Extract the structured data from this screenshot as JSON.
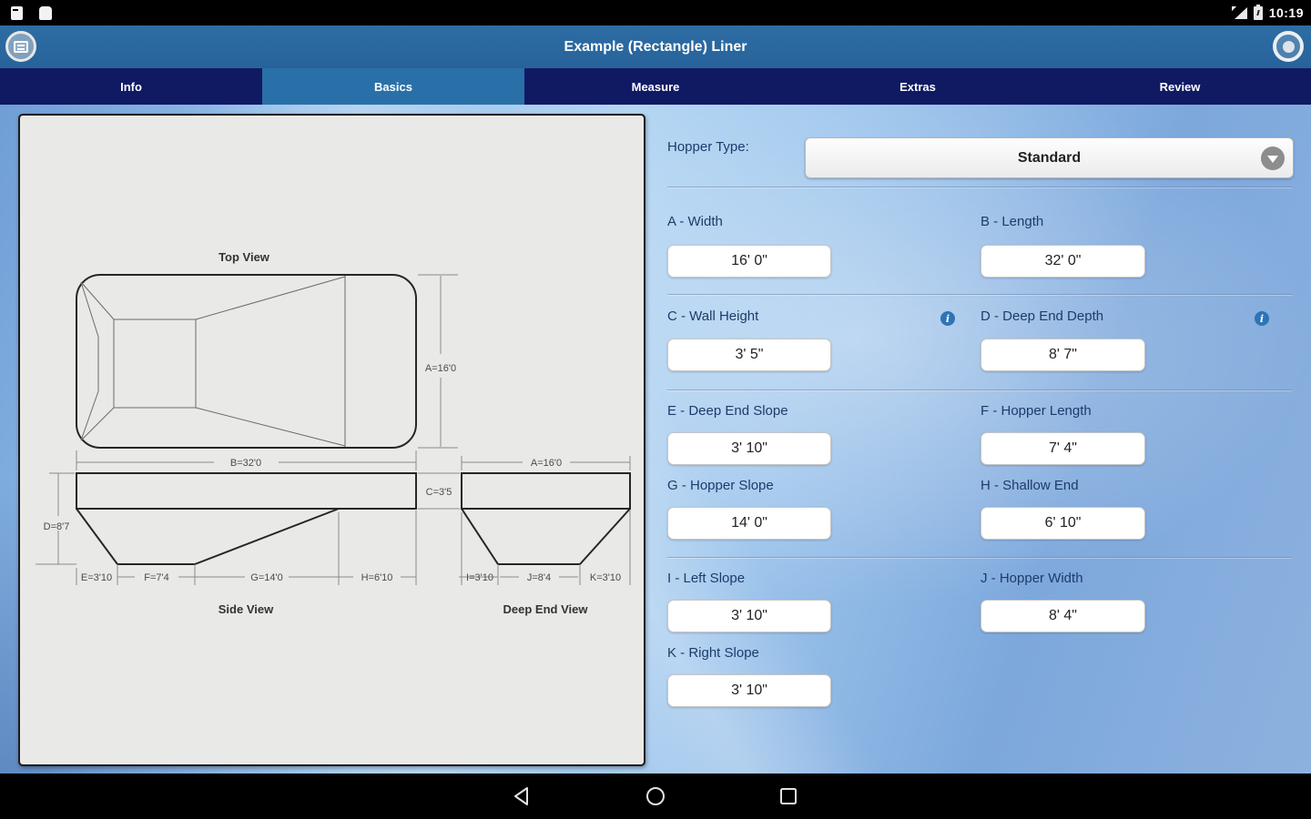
{
  "status_bar": {
    "time": "10:19"
  },
  "header": {
    "title": "Example (Rectangle) Liner"
  },
  "tabs": [
    {
      "label": "Info",
      "selected": false
    },
    {
      "label": "Basics",
      "selected": true
    },
    {
      "label": "Measure",
      "selected": false
    },
    {
      "label": "Extras",
      "selected": false
    },
    {
      "label": "Review",
      "selected": false
    }
  ],
  "diagram": {
    "titles": {
      "top": "Top View",
      "side": "Side View",
      "deep": "Deep End View"
    },
    "dims": {
      "A": "A=16'0",
      "B": "B=32'0",
      "C": "C=3'5",
      "D": "D=8'7",
      "E": "E=3'10",
      "F": "F=7'4",
      "G": "G=14'0",
      "H": "H=6'10",
      "I": "I=3'10",
      "J": "J=8'4",
      "K": "K=3'10"
    }
  },
  "form": {
    "hopper_label": "Hopper Type:",
    "hopper_value": "Standard",
    "fields": [
      {
        "id": "A",
        "label": "A - Width",
        "value": "16' 0\""
      },
      {
        "id": "B",
        "label": "B - Length",
        "value": "32' 0\""
      },
      {
        "id": "C",
        "label": "C - Wall Height",
        "value": "3' 5\""
      },
      {
        "id": "D",
        "label": "D - Deep End Depth",
        "value": "8' 7\""
      },
      {
        "id": "E",
        "label": "E - Deep End Slope",
        "value": "3' 10\""
      },
      {
        "id": "F",
        "label": "F - Hopper Length",
        "value": "7' 4\""
      },
      {
        "id": "G",
        "label": "G - Hopper Slope",
        "value": "14' 0\""
      },
      {
        "id": "H",
        "label": "H - Shallow End",
        "value": "6' 10\""
      },
      {
        "id": "I",
        "label": "I - Left Slope",
        "value": "3' 10\""
      },
      {
        "id": "J",
        "label": "J - Hopper Width",
        "value": "8' 4\""
      },
      {
        "id": "K",
        "label": "K - Right Slope",
        "value": "3' 10\""
      }
    ]
  },
  "colors": {
    "header_blue": "#29679c",
    "tabbar_navy": "#101a63",
    "tab_selected_blue": "#2a70a8",
    "info_icon_blue": "#2e74b5",
    "panel_gray": "#e9e9e7"
  },
  "icons": {
    "header_left": "list-menu-icon",
    "header_right": "info-circle-icon",
    "status": [
      "notification-icon",
      "notification-icon",
      "signal-icon",
      "battery-icon"
    ],
    "dropdown": "chevron-down-icon",
    "field_help": "info-icon",
    "nav": [
      "back-icon",
      "home-icon",
      "recents-icon"
    ]
  }
}
